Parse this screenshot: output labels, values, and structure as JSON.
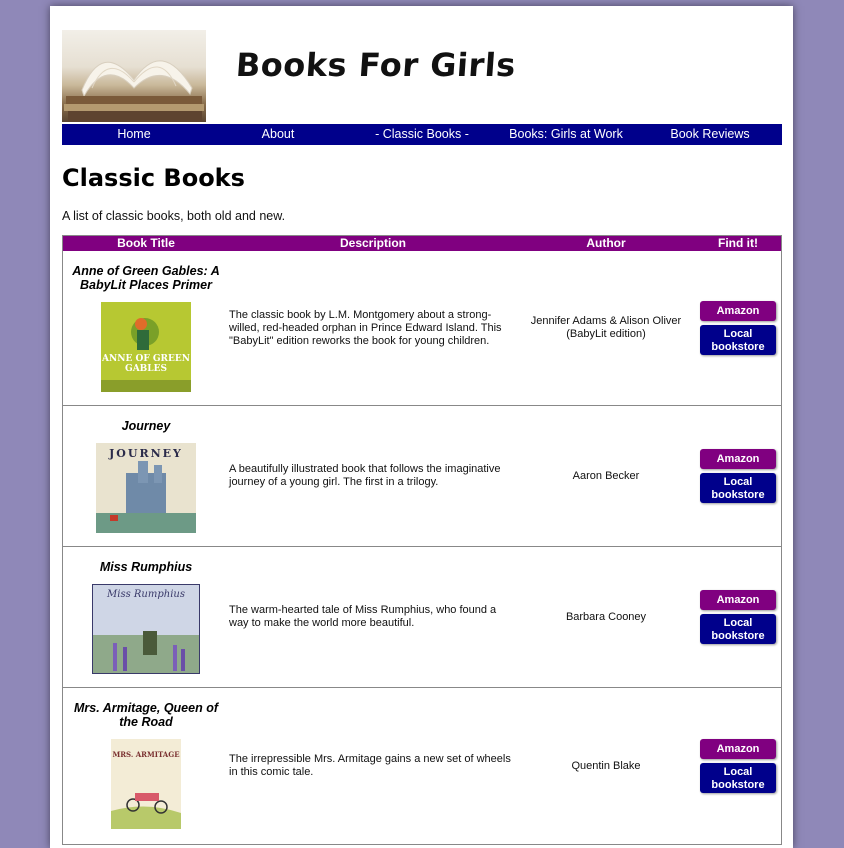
{
  "site": {
    "title": "Books For Girls"
  },
  "nav": {
    "items": [
      {
        "label": "Home"
      },
      {
        "label": "About"
      },
      {
        "label": "- Classic Books -"
      },
      {
        "label": "Books: Girls at Work"
      },
      {
        "label": "Book Reviews"
      }
    ]
  },
  "page": {
    "title": "Classic Books",
    "intro": "A list of classic books, both old and new."
  },
  "table": {
    "headers": {
      "title": "Book Title",
      "description": "Description",
      "author": "Author",
      "find": "Find it!"
    },
    "rows": [
      {
        "title": "Anne of Green Gables: A BabyLit Places Primer",
        "description": "The classic book by L.M. Montgomery about a strong-willed, red-headed orphan in Prince Edward Island. This \"BabyLit\" edition reworks the book for young children.",
        "author": "Jennifer Adams & Alison Oliver (BabyLit edition)",
        "amazon_label": "Amazon",
        "local_label": "Local bookstore",
        "cover_text": "ANNE OF GREEN GABLES"
      },
      {
        "title": "Journey",
        "description": "A beautifully illustrated book that follows the imaginative journey of a young girl. The first in a trilogy.",
        "author": "Aaron Becker",
        "amazon_label": "Amazon",
        "local_label": "Local bookstore",
        "cover_text": "JOURNEY"
      },
      {
        "title": "Miss Rumphius",
        "description": "The warm-hearted tale of Miss Rumphius, who found a way to make the world more beautiful.",
        "author": "Barbara Cooney",
        "amazon_label": "Amazon",
        "local_label": "Local bookstore",
        "cover_text": "Miss Rumphius"
      },
      {
        "title": "Mrs. Armitage, Queen of the Road",
        "description": "The irrepressible Mrs. Armitage gains a new set of wheels in this comic tale.",
        "author": "Quentin Blake",
        "amazon_label": "Amazon",
        "local_label": "Local bookstore",
        "cover_text": "MRS. ARMITAGE"
      }
    ]
  },
  "colors": {
    "background": "#8f88b8",
    "nav": "#00008b",
    "header_row": "#800080",
    "amazon_button": "#800080",
    "local_button": "#00008b"
  }
}
